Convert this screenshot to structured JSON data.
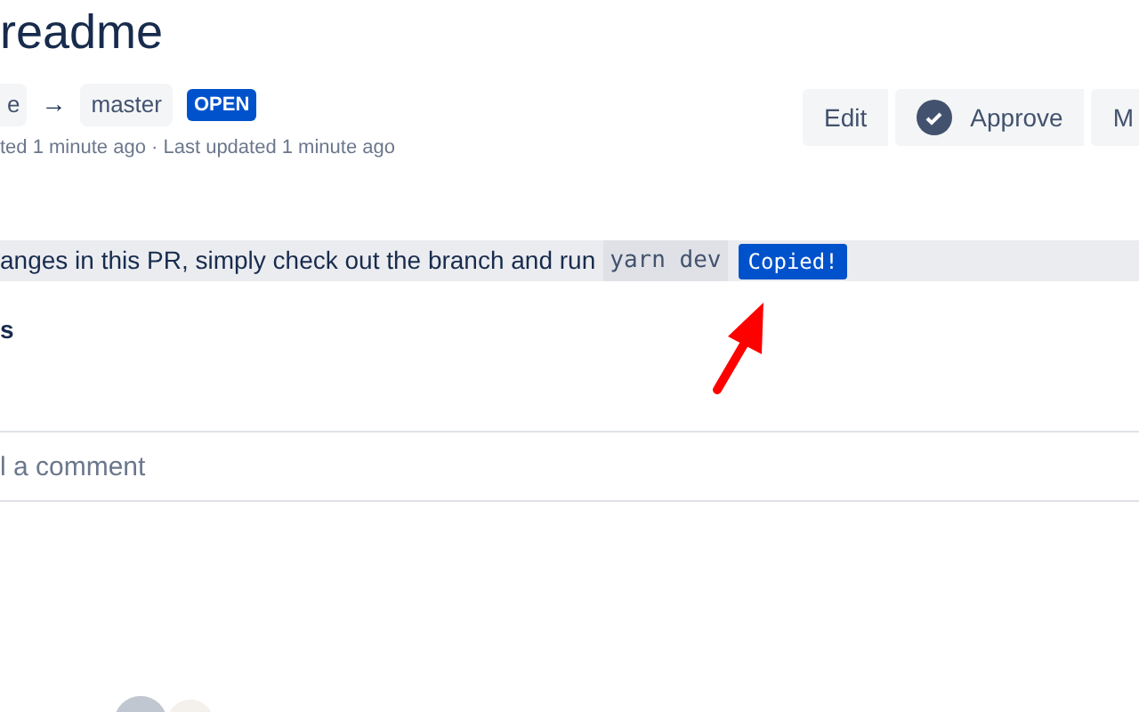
{
  "title": "readme",
  "branches": {
    "source": "e",
    "arrow": "→",
    "target": "master"
  },
  "status": {
    "label": "OPEN"
  },
  "meta": "ted 1 minute ago · Last updated 1 minute ago",
  "actions": [
    {
      "label": "Edit",
      "kind": "plain"
    },
    {
      "label": "Approve",
      "kind": "approve"
    },
    {
      "label": "M",
      "kind": "plain"
    }
  ],
  "description": {
    "text": "anges in this PR, simply check out the branch and run",
    "code": "yarn dev",
    "copied": "Copied!"
  },
  "section_heading": "s",
  "comment_field": {
    "placeholder": "l a comment"
  }
}
